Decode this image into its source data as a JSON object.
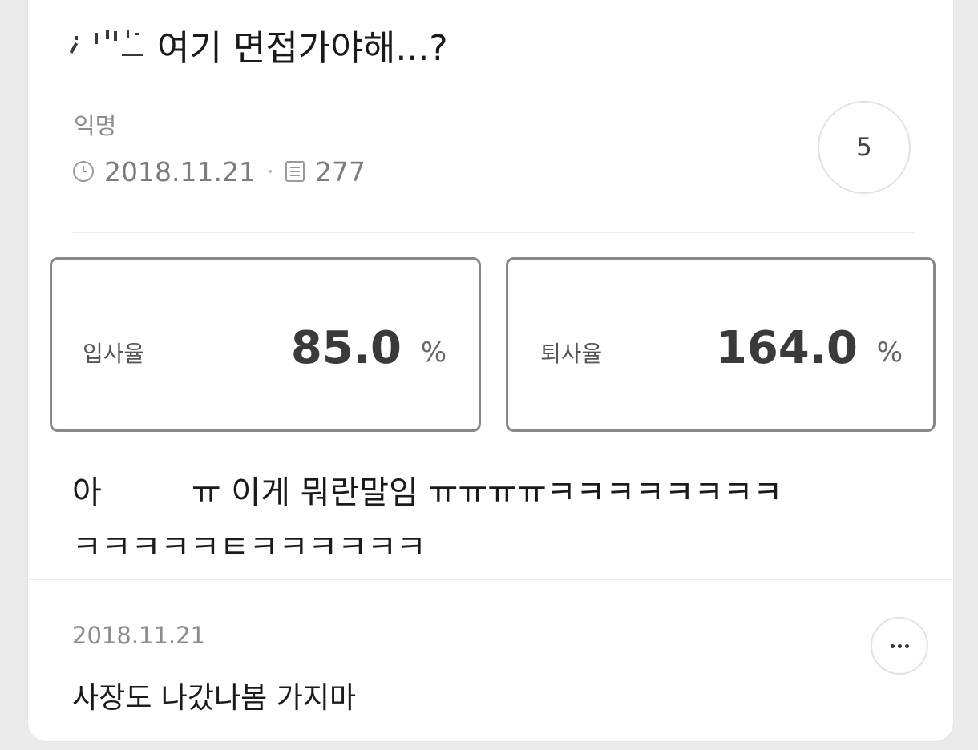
{
  "post": {
    "title": "여기 면접가야해...?",
    "author": "익명",
    "date": "2018.11.21",
    "views": "277",
    "comment_count": "5"
  },
  "stats": {
    "hire": {
      "label": "입사율",
      "value": "85.0",
      "unit": "%"
    },
    "quit": {
      "label": "퇴사율",
      "value": "164.0",
      "unit": "%"
    }
  },
  "content": {
    "line1_start": "아",
    "line1_rest": "ㅠ 이게 뭐란말임 ㅠㅠㅠㅠㅋㅋㅋㅋㅋㅋㅋㅋ",
    "line2": "ㅋㅋㅋㅋㅋㅌㅋㅋㅋㅋㅋㅋ"
  },
  "comment": {
    "date": "2018.11.21",
    "text": "사장도 나갔나봄 가지마"
  },
  "icons": {
    "clock": "clock-icon",
    "views": "document-icon",
    "more": "more-icon"
  }
}
